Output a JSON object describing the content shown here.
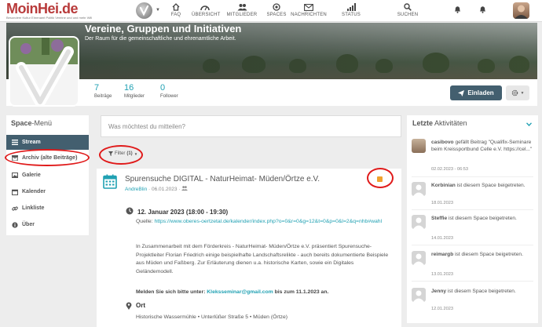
{
  "logo": {
    "title": "MoinHei.de",
    "subtitle": "Besondere Kultur Ehrenamt Politik Vereine und und mehr Will"
  },
  "nav": [
    {
      "label": "FAQ",
      "icon": "home-icon"
    },
    {
      "label": "ÜBERSICHT",
      "icon": "tachometer-icon"
    },
    {
      "label": "MITGLIEDER",
      "icon": "users-icon"
    },
    {
      "label": "SPACES",
      "icon": "dot-circle-icon"
    },
    {
      "label": "NACHRICHTEN",
      "icon": "envelope-icon"
    },
    {
      "label": "STATUS",
      "icon": "signal-icon"
    },
    {
      "label": "SUCHEN",
      "icon": "search-icon"
    }
  ],
  "space": {
    "title": "Vereine, Gruppen und Initiativen",
    "subtitle": "Der Raum für die gemeinschaftliche und ehrenamtliche Arbeit.",
    "stats": [
      {
        "num": "7",
        "label": "Beiträge"
      },
      {
        "num": "16",
        "label": "Mitglieder"
      },
      {
        "num": "0",
        "label": "Follower"
      }
    ],
    "invite_label": "Einladen"
  },
  "menu": {
    "title_bold": "Space",
    "title_rest": "-Menü",
    "items": [
      {
        "label": "Stream",
        "icon": "bars-icon"
      },
      {
        "label": "Archiv (alte Beiträge)",
        "icon": "archive-icon"
      },
      {
        "label": "Galerie",
        "icon": "image-icon"
      },
      {
        "label": "Kalender",
        "icon": "calendar-icon"
      },
      {
        "label": "Linkliste",
        "icon": "link-icon"
      },
      {
        "label": "Über",
        "icon": "info-circle-icon"
      }
    ]
  },
  "composer": {
    "placeholder": "Was möchtest du mitteilen?"
  },
  "filter": {
    "label": "Filter",
    "count": "(1)"
  },
  "post": {
    "title": "Spurensuche DIGITAL - NaturHeimat- Müden/Örtze e.V.",
    "author": "AndreBlin",
    "date": "· 06.01.2023 ·",
    "event_date": "12. Januar 2023 (18:00 - 19:30)",
    "source_label": "Quelle:",
    "source_url": "https://www.oberes-oertzetal.de/kalender/index.php?o=0&r=0&g=12&t=0&p=0&l=2&q=nhb#wahl",
    "body": "In Zusammenarbeit mit dem Förderkreis - NaturHeimat- Müden/Örtze e.V. präsentiert Spurensuche-Projektleiter Florian Friedrich einige beispielhafte Landschaftsrelikte - auch bereits dokumentierte Beispiele aus Müden und Faßberg. Zur Erläuterung dienen u.a. historische Karten, sowie ein Digitales Geländemodell.",
    "register_pre": "Melden Sie sich bitte unter:",
    "register_email": "Kleksseminar@gmail.com",
    "register_post": "bis zum 11.1.2023 an.",
    "location_title": "Ort",
    "location": "Historische Wassermühle • Unterlüßer Straße 5 • Müden (Örtze)"
  },
  "activities": {
    "title_bold": "Letzte",
    "title_rest": " Aktivitäten",
    "items": [
      {
        "name": "casibovo",
        "text": "gefällt Beitrag \"Qualifix-Seminare beim Kreissportbund Celle e.V. https://cel...\"",
        "date": "02.02.2023 - 06:53"
      },
      {
        "name": "Korbinian",
        "text": "ist diesem Space beigetreten.",
        "date": "18.01.2023"
      },
      {
        "name": "Steffie",
        "text": "ist diesem Space beigetreten.",
        "date": "14.01.2023"
      },
      {
        "name": "reimargb",
        "text": "ist diesem Space beigetreten.",
        "date": "13.01.2023"
      },
      {
        "name": "Jenny",
        "text": "ist diesem Space beigetreten.",
        "date": "12.01.2023"
      }
    ]
  },
  "colors": {
    "accent": "#21a1b3",
    "primary": "#435f6f",
    "logo": "#b83a3a",
    "highlight": "#e01a1a"
  }
}
